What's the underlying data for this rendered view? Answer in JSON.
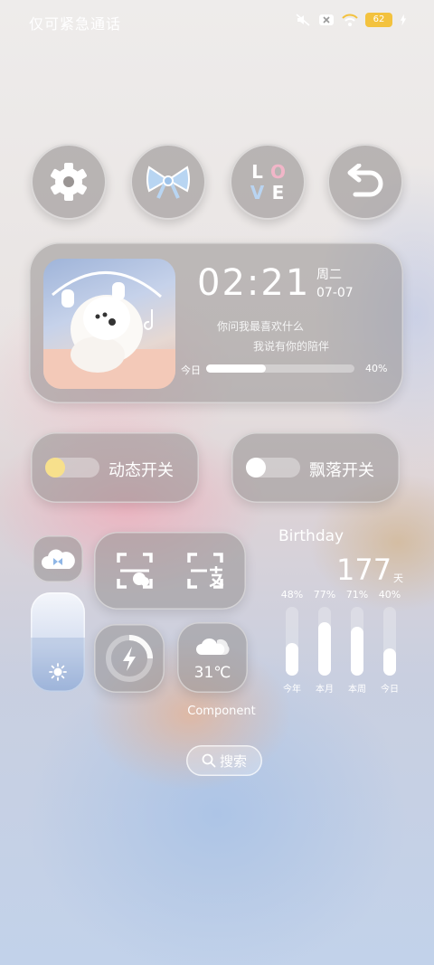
{
  "status_bar": {
    "carrier": "仅可紧急通话",
    "battery": "62"
  },
  "shortcuts": {
    "love_letters": [
      "L",
      "O",
      "V",
      "E"
    ]
  },
  "music": {
    "time": "02:21",
    "weekday": "周二",
    "date": "07-07",
    "lyric_line1": "你问我最喜欢什么",
    "lyric_line2": "我说有你的陪伴",
    "progress_label": "今日",
    "progress_text": "40%",
    "progress_value": 0.4
  },
  "toggles": [
    {
      "label": "动态开关",
      "on": true,
      "knob_color": "#f7e08c"
    },
    {
      "label": "飘落开关",
      "on": false,
      "knob_color": "#ffffff"
    }
  ],
  "brightness_level": 0.55,
  "weather": {
    "temp": "31℃"
  },
  "component_label": "Component",
  "search": {
    "label": "搜索"
  },
  "birthday": {
    "title": "Birthday",
    "days": "177",
    "unit": "天",
    "stats": [
      {
        "label": "今年",
        "text": "48%",
        "value": 0.48
      },
      {
        "label": "本月",
        "text": "77%",
        "value": 0.77
      },
      {
        "label": "本周",
        "text": "71%",
        "value": 0.71
      },
      {
        "label": "今日",
        "text": "40%",
        "value": 0.4
      }
    ]
  }
}
